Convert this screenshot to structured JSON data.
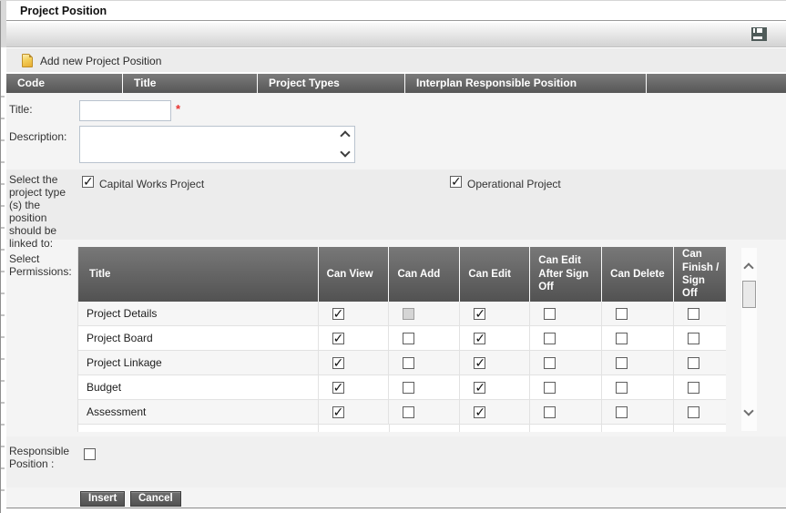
{
  "window": {
    "title": "Project Position"
  },
  "toolbar": {
    "save_icon": "save"
  },
  "add_new": {
    "label": "Add new Project Position"
  },
  "grid": {
    "columns": [
      "Code",
      "Title",
      "Project Types",
      "Interplan Responsible Position",
      ""
    ]
  },
  "form": {
    "title_label": "Title:",
    "title_value": "",
    "required_marker": "*",
    "description_label": "Description:",
    "description_value": "",
    "project_type_label": "Select the project type (s) the position should be linked to:",
    "project_types": [
      {
        "label": "Capital Works Project",
        "state": "checked"
      },
      {
        "label": "Operational Project",
        "state": "checked"
      }
    ],
    "permissions_label": "Select Permissions:",
    "responsible_label": "Responsible Position :",
    "responsible_state": "unchecked"
  },
  "permissions": {
    "columns": [
      "Title",
      "Can View",
      "Can Add",
      "Can Edit",
      "Can Edit After Sign Off",
      "Can Delete",
      "Can Finish / Sign Off"
    ],
    "rows": [
      {
        "title": "Project Details",
        "states": [
          "checked",
          "disabled",
          "checked",
          "unchecked",
          "unchecked",
          "unchecked"
        ]
      },
      {
        "title": "Project Board",
        "states": [
          "checked",
          "unchecked",
          "checked",
          "unchecked",
          "unchecked",
          "unchecked"
        ]
      },
      {
        "title": "Project Linkage",
        "states": [
          "checked",
          "unchecked",
          "checked",
          "unchecked",
          "unchecked",
          "unchecked"
        ]
      },
      {
        "title": "Budget",
        "states": [
          "checked",
          "unchecked",
          "checked",
          "unchecked",
          "unchecked",
          "unchecked"
        ]
      },
      {
        "title": "Assessment",
        "states": [
          "checked",
          "unchecked",
          "checked",
          "unchecked",
          "unchecked",
          "unchecked"
        ]
      }
    ]
  },
  "buttons": {
    "insert": "Insert",
    "cancel": "Cancel"
  },
  "colors": {
    "grid_header": "#5f5f5f",
    "button": "#5a5a5a",
    "required": "#e8322e",
    "add_icon": "#eebc3a",
    "save_icon": "#4f5b59"
  }
}
